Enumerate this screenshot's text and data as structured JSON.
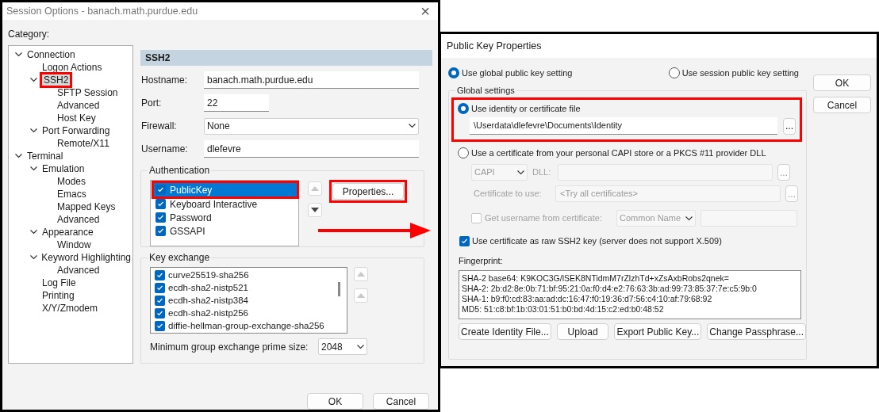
{
  "session_options": {
    "title": "Session Options - banach.math.purdue.edu",
    "close": "×",
    "category_label": "Category:",
    "tree": [
      {
        "label": "Connection",
        "expanded": true,
        "selected": false,
        "highlighted": false,
        "children": [
          {
            "label": "Logon Actions",
            "selected": false,
            "highlighted": false
          },
          {
            "label": "SSH2",
            "expanded": true,
            "selected": true,
            "highlighted": true,
            "children": [
              {
                "label": "SFTP Session",
                "selected": false,
                "highlighted": false
              },
              {
                "label": "Advanced",
                "selected": false,
                "highlighted": false
              },
              {
                "label": "Host Key",
                "selected": false,
                "highlighted": false
              }
            ]
          },
          {
            "label": "Port Forwarding",
            "expanded": true,
            "selected": false,
            "highlighted": false,
            "children": [
              {
                "label": "Remote/X11",
                "selected": false,
                "highlighted": false
              }
            ]
          }
        ]
      },
      {
        "label": "Terminal",
        "expanded": true,
        "selected": false,
        "highlighted": false,
        "children": [
          {
            "label": "Emulation",
            "expanded": true,
            "selected": false,
            "highlighted": false,
            "children": [
              {
                "label": "Modes",
                "selected": false,
                "highlighted": false
              },
              {
                "label": "Emacs",
                "selected": false,
                "highlighted": false
              },
              {
                "label": "Mapped Keys",
                "selected": false,
                "highlighted": false
              },
              {
                "label": "Advanced",
                "selected": false,
                "highlighted": false
              }
            ]
          },
          {
            "label": "Appearance",
            "expanded": true,
            "selected": false,
            "highlighted": false,
            "children": [
              {
                "label": "Window",
                "selected": false,
                "highlighted": false
              }
            ]
          },
          {
            "label": "Keyword Highlighting",
            "expanded": true,
            "selected": false,
            "highlighted": false,
            "children": [
              {
                "label": "Advanced",
                "selected": false,
                "highlighted": false
              }
            ]
          },
          {
            "label": "Log File",
            "selected": false,
            "highlighted": false
          },
          {
            "label": "Printing",
            "selected": false,
            "highlighted": false
          },
          {
            "label": "X/Y/Zmodem",
            "selected": false,
            "highlighted": false
          }
        ]
      }
    ],
    "panel_title": "SSH2",
    "fields": [
      {
        "kind": "text",
        "label": "Hostname:",
        "value": "banach.math.purdue.edu"
      },
      {
        "kind": "text",
        "label": "Port:",
        "value": "22"
      },
      {
        "kind": "dropdown",
        "label": "Firewall:",
        "value": "None"
      },
      {
        "kind": "text",
        "label": "Username:",
        "value": "dlefevre"
      }
    ],
    "authentication": {
      "title": "Authentication",
      "methods": [
        {
          "label": "PublicKey",
          "checked": true,
          "selected": true,
          "highlighted": true
        },
        {
          "label": "Keyboard Interactive",
          "checked": true,
          "selected": false,
          "highlighted": false
        },
        {
          "label": "Password",
          "checked": true,
          "selected": false,
          "highlighted": false
        },
        {
          "label": "GSSAPI",
          "checked": true,
          "selected": false,
          "highlighted": false
        }
      ],
      "properties_button": {
        "label": "Properties...",
        "highlighted": true
      }
    },
    "key_exchange": {
      "title": "Key exchange",
      "items": [
        {
          "label": "curve25519-sha256",
          "checked": true
        },
        {
          "label": "ecdh-sha2-nistp521",
          "checked": true
        },
        {
          "label": "ecdh-sha2-nistp384",
          "checked": true
        },
        {
          "label": "ecdh-sha2-nistp256",
          "checked": true
        },
        {
          "label": "diffie-hellman-group-exchange-sha256",
          "checked": true
        }
      ],
      "prime_size_label": "Minimum group exchange prime size:",
      "prime_size": "2048"
    },
    "buttons": [
      "OK",
      "Cancel"
    ]
  },
  "public_key_properties": {
    "title": "Public Key Properties",
    "scope": [
      {
        "label": "Use global public key setting",
        "selected": true
      },
      {
        "label": "Use session public key setting",
        "selected": false
      }
    ],
    "buttons": [
      "OK",
      "Cancel"
    ],
    "global_settings": {
      "title": "Global settings",
      "identity": {
        "label": "Use identity or certificate file",
        "selected": true,
        "highlighted": true,
        "path": "\\Userdata\\dlefevre\\Documents\\Identity",
        "browse": "..."
      },
      "capi": {
        "label": "Use a certificate from your personal CAPI store or a PKCS #11 provider DLL",
        "selected": false,
        "disabled": true,
        "store": "CAPI",
        "dll_label": "DLL:",
        "dll_browse": "...",
        "cert_label": "Certificate to use:",
        "cert_value": "<Try all certificates>",
        "cert_browse": "...",
        "username_label": "Get username from certificate:",
        "username_checked": false,
        "username_source": "Common Name"
      },
      "raw_key": {
        "label": "Use certificate as raw SSH2 key (server does not support X.509)",
        "checked": true
      },
      "fingerprint_label": "Fingerprint:",
      "fingerprint": [
        "SHA-2 base64: K9KOC3G/lSEK8NTidmM7rZlzhTd+xZsAxbRobs2qnek=",
        "SHA-2: 2b:d2:8e:0b:71:bf:95:21:0a:f0:d4:e2:76:63:3b:ad:99:73:85:37:7e:c5:9b:0",
        "SHA-1: b9:f0:cd:83:aa:ad:dc:16:47:f0:19:36:d7:56:c4:10:af:79:68:92",
        "MD5: 51:c8:bf:1b:03:01:51:b0:bd:4d:15:c2:ed:b0:48:52"
      ],
      "actions": [
        "Create Identity File...",
        "Upload",
        "Export Public Key...",
        "Change Passphrase..."
      ]
    }
  },
  "annotation_arrow": true
}
